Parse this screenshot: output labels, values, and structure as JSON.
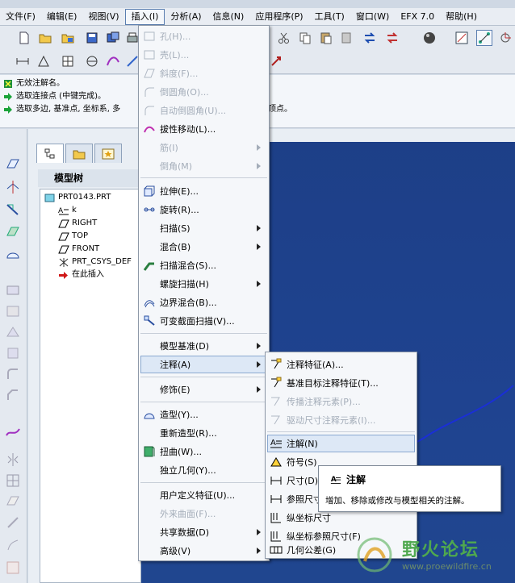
{
  "menubar": {
    "items": [
      {
        "label": "文件(F)"
      },
      {
        "label": "编辑(E)"
      },
      {
        "label": "视图(V)"
      },
      {
        "label": "插入(I)"
      },
      {
        "label": "分析(A)"
      },
      {
        "label": "信息(N)"
      },
      {
        "label": "应用程序(P)"
      },
      {
        "label": "工具(T)"
      },
      {
        "label": "窗口(W)"
      },
      {
        "label": "EFX 7.0"
      },
      {
        "label": "帮助(H)"
      }
    ]
  },
  "messages": [
    {
      "text": "无效注解名。",
      "icon": "error-icon"
    },
    {
      "text": "选取连接点 (中键完成)。",
      "icon": "arrow-prompt-icon"
    },
    {
      "text": "选取多边, 基准点, 坐标系, 多",
      "tail": "顶点。",
      "icon": "arrow-prompt-icon"
    }
  ],
  "panel": {
    "title": "模型树",
    "tree": [
      {
        "label": "PRT0143.PRT",
        "icon": "part-icon"
      },
      {
        "label": "k",
        "icon": "note-icon"
      },
      {
        "label": "RIGHT",
        "icon": "datum-plane-icon"
      },
      {
        "label": "TOP",
        "icon": "datum-plane-icon"
      },
      {
        "label": "FRONT",
        "icon": "datum-plane-icon"
      },
      {
        "label": "PRT_CSYS_DEF",
        "icon": "csys-icon"
      },
      {
        "label": "在此插入",
        "icon": "insert-here-icon"
      }
    ]
  },
  "insert_menu": {
    "items": [
      {
        "label": "孔(H)...",
        "disabled": true
      },
      {
        "label": "壳(L)...",
        "disabled": true
      },
      {
        "label": "斜度(F)...",
        "disabled": true
      },
      {
        "label": "倒圆角(O)...",
        "disabled": true
      },
      {
        "label": "自动倒圆角(U)...",
        "disabled": true
      },
      {
        "label": "拔性移动(L)...",
        "disabled": false
      },
      {
        "label": "筋(I)",
        "disabled": true
      },
      {
        "label": "倒角(M)",
        "disabled": true
      },
      {
        "label": "拉伸(E)...",
        "disabled": false
      },
      {
        "label": "旋转(R)...",
        "disabled": false
      },
      {
        "label": "扫描(S)",
        "disabled": false
      },
      {
        "label": "混合(B)",
        "disabled": false
      },
      {
        "label": "扫描混合(S)...",
        "disabled": false
      },
      {
        "label": "螺旋扫描(H)",
        "disabled": false
      },
      {
        "label": "边界混合(B)...",
        "disabled": false
      },
      {
        "label": "可变截面扫描(V)...",
        "disabled": false
      },
      {
        "label": "模型基准(D)",
        "disabled": false
      },
      {
        "label": "注释(A)",
        "disabled": false
      },
      {
        "label": "修饰(E)",
        "disabled": false
      },
      {
        "label": "造型(Y)...",
        "disabled": false
      },
      {
        "label": "重新造型(R)...",
        "disabled": false
      },
      {
        "label": "扭曲(W)...",
        "disabled": false
      },
      {
        "label": "独立几何(Y)...",
        "disabled": false
      },
      {
        "label": "用户定义特征(U)...",
        "disabled": false
      },
      {
        "label": "外来曲面(F)...",
        "disabled": true
      },
      {
        "label": "共享数据(D)",
        "disabled": false
      },
      {
        "label": "高级(V)",
        "disabled": false
      }
    ]
  },
  "annotation_submenu": {
    "items": [
      {
        "label": "注释特征(A)...",
        "disabled": false
      },
      {
        "label": "基准目标注释特征(T)...",
        "disabled": false
      },
      {
        "label": "传播注释元素(P)...",
        "disabled": true
      },
      {
        "label": "驱动尺寸注释元素(I)...",
        "disabled": true
      },
      {
        "label": "注解(N)",
        "disabled": false
      },
      {
        "label": "符号(S)",
        "disabled": false
      },
      {
        "label": "尺寸(D)",
        "disabled": false
      },
      {
        "label": "参照尺寸",
        "disabled": false
      },
      {
        "label": "纵坐标尺寸",
        "disabled": false
      },
      {
        "label": "纵坐标参照尺寸(F)",
        "disabled": false
      },
      {
        "label": "几何公差(G)",
        "disabled": false
      }
    ]
  },
  "tooltip": {
    "title": "注解",
    "description": "增加、移除或修改与模型相关的注解。"
  },
  "watermark": {
    "name": "野火论坛",
    "url": "www.proewildfire.cn"
  },
  "colors": {
    "graphics_bg": "#1f4390",
    "menu_bg": "#f5f7fa",
    "annotation_arrow": "#1a2fd6",
    "watermark_green": "#4fa84f"
  }
}
